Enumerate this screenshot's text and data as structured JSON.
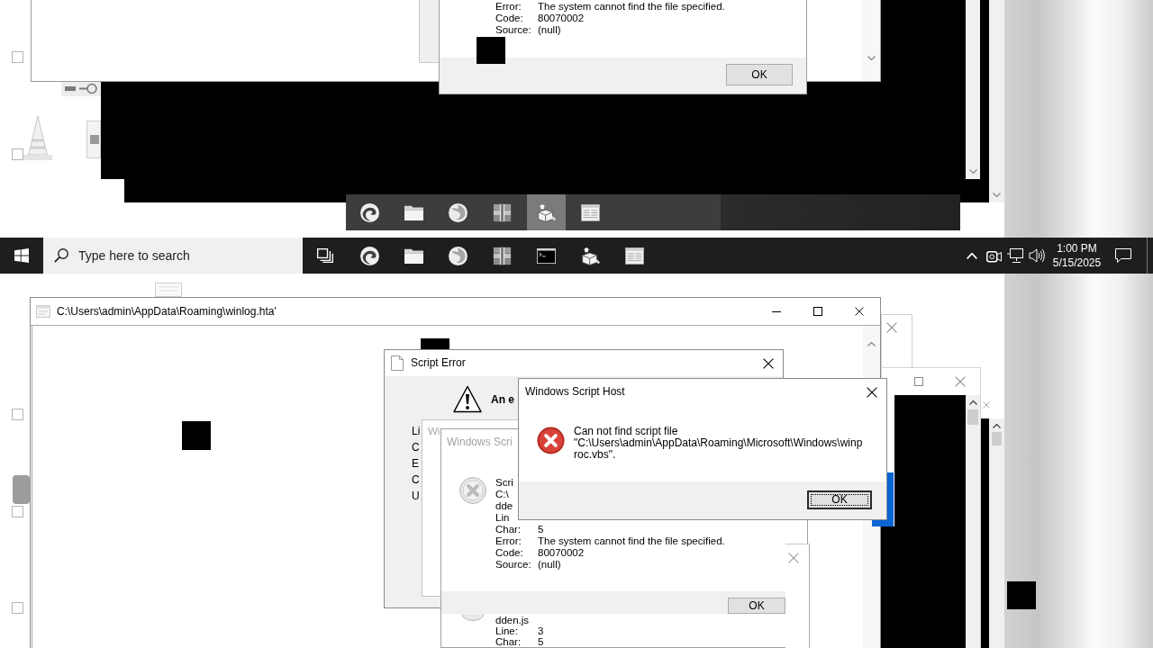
{
  "top_dialog": {
    "fields": [
      {
        "label": "Error:",
        "value": "The system cannot find the file specified."
      },
      {
        "label": "Code:",
        "value": "80070002"
      },
      {
        "label": "Source:",
        "value": "(null)"
      }
    ],
    "ok_button": {
      "label": "OK",
      "focused": false
    }
  },
  "ghost_taskbar": {
    "apps": [
      {
        "kind": "edge",
        "selected": false
      },
      {
        "kind": "folder",
        "selected": false
      },
      {
        "kind": "firefox",
        "selected": false
      },
      {
        "kind": "archive",
        "selected": false
      },
      {
        "kind": "installer",
        "selected": true
      },
      {
        "kind": "document",
        "selected": false
      }
    ]
  },
  "taskbar": {
    "search": {
      "placeholder": "Type here to search"
    },
    "apps": [
      {
        "kind": "taskview",
        "selected": false
      },
      {
        "kind": "edge",
        "selected": false
      },
      {
        "kind": "folder",
        "selected": false
      },
      {
        "kind": "firefox",
        "selected": false
      },
      {
        "kind": "archive",
        "selected": false
      },
      {
        "kind": "terminal",
        "selected": false
      },
      {
        "kind": "installer",
        "selected": false
      },
      {
        "kind": "document",
        "selected": false
      }
    ],
    "clock": {
      "time": "1:00 PM",
      "date": "5/15/2025"
    }
  },
  "hta_window": {
    "title": "C:\\Users\\admin\\AppData\\Roaming\\winlog.hta'"
  },
  "script_error": {
    "title": "Script Error",
    "heading": "An e",
    "labels": [
      "Li",
      "C",
      "E",
      "C",
      "U"
    ]
  },
  "faded_dialog": {
    "title": "Wi"
  },
  "back_host_dialog": {
    "title": "Windows Scri",
    "lines": [
      "Scri",
      "C:\\",
      "dde",
      "Lin"
    ],
    "fields": [
      {
        "label": "Char:",
        "value": "5"
      },
      {
        "label": "Error:",
        "value": "The system cannot find the file specified."
      },
      {
        "label": "Code:",
        "value": "80070002"
      },
      {
        "label": "Source:",
        "value": "(null)"
      }
    ],
    "ok_button": {
      "label": "OK",
      "focused": false
    },
    "lower_lines": [
      "dden.js"
    ],
    "lower_fields": [
      {
        "label": "Line:",
        "value": "3"
      },
      {
        "label": "Char:",
        "value": "5"
      }
    ]
  },
  "host_dialog": {
    "title": "Windows Script Host",
    "message_lines": [
      "Can not find script file",
      "\"C:\\Users\\admin\\AppData\\Roaming\\Microsoft\\Windows\\winp",
      "roc.vbs\"."
    ],
    "ok_button": {
      "label": "OK",
      "focused": true
    }
  }
}
